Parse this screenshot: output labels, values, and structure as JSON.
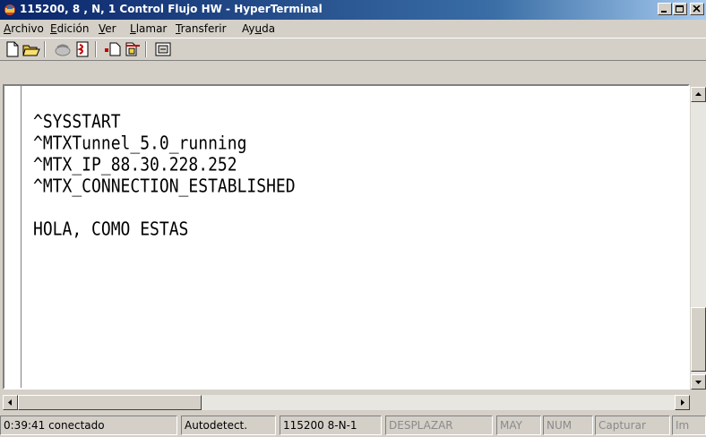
{
  "window": {
    "title": "115200, 8 , N, 1  Control Flujo HW - HyperTerminal"
  },
  "menu": [
    {
      "label": "Archivo",
      "accel": "A",
      "rest": "rchivo"
    },
    {
      "label": "Edición",
      "accel": "E",
      "rest": "dición"
    },
    {
      "label": "Ver",
      "accel": "V",
      "rest": "er"
    },
    {
      "label": "Llamar",
      "accel": "L",
      "rest": "lamar"
    },
    {
      "label": "Transferir",
      "accel": "T",
      "rest": "ransferir"
    },
    {
      "label": "Ayuda",
      "pre": "Ay",
      "accel": "u",
      "rest": "da"
    }
  ],
  "toolbar": {
    "buttons": [
      "new-connection-icon",
      "open-icon",
      "disconnect-icon",
      "dial-icon",
      "send-icon",
      "receive-icon",
      "properties-icon"
    ]
  },
  "terminal": {
    "lines": [
      "^SYSSTART",
      "^MTXTunnel_5.0_running",
      "^MTX_IP_88.30.228.252",
      "^MTX_CONNECTION_ESTABLISHED",
      "",
      "HOLA, COMO ESTAS"
    ]
  },
  "status": {
    "time": "0:39:41 conectado",
    "detect": "Autodetect.",
    "params": "115200 8-N-1",
    "scroll": "DESPLAZAR",
    "caps": "MAY",
    "num": "NUM",
    "capture": "Capturar",
    "print": "Im"
  },
  "colors": {
    "titlebar_start": "#0a246a",
    "titlebar_end": "#a6caf0",
    "chrome": "#d4d0c8"
  }
}
